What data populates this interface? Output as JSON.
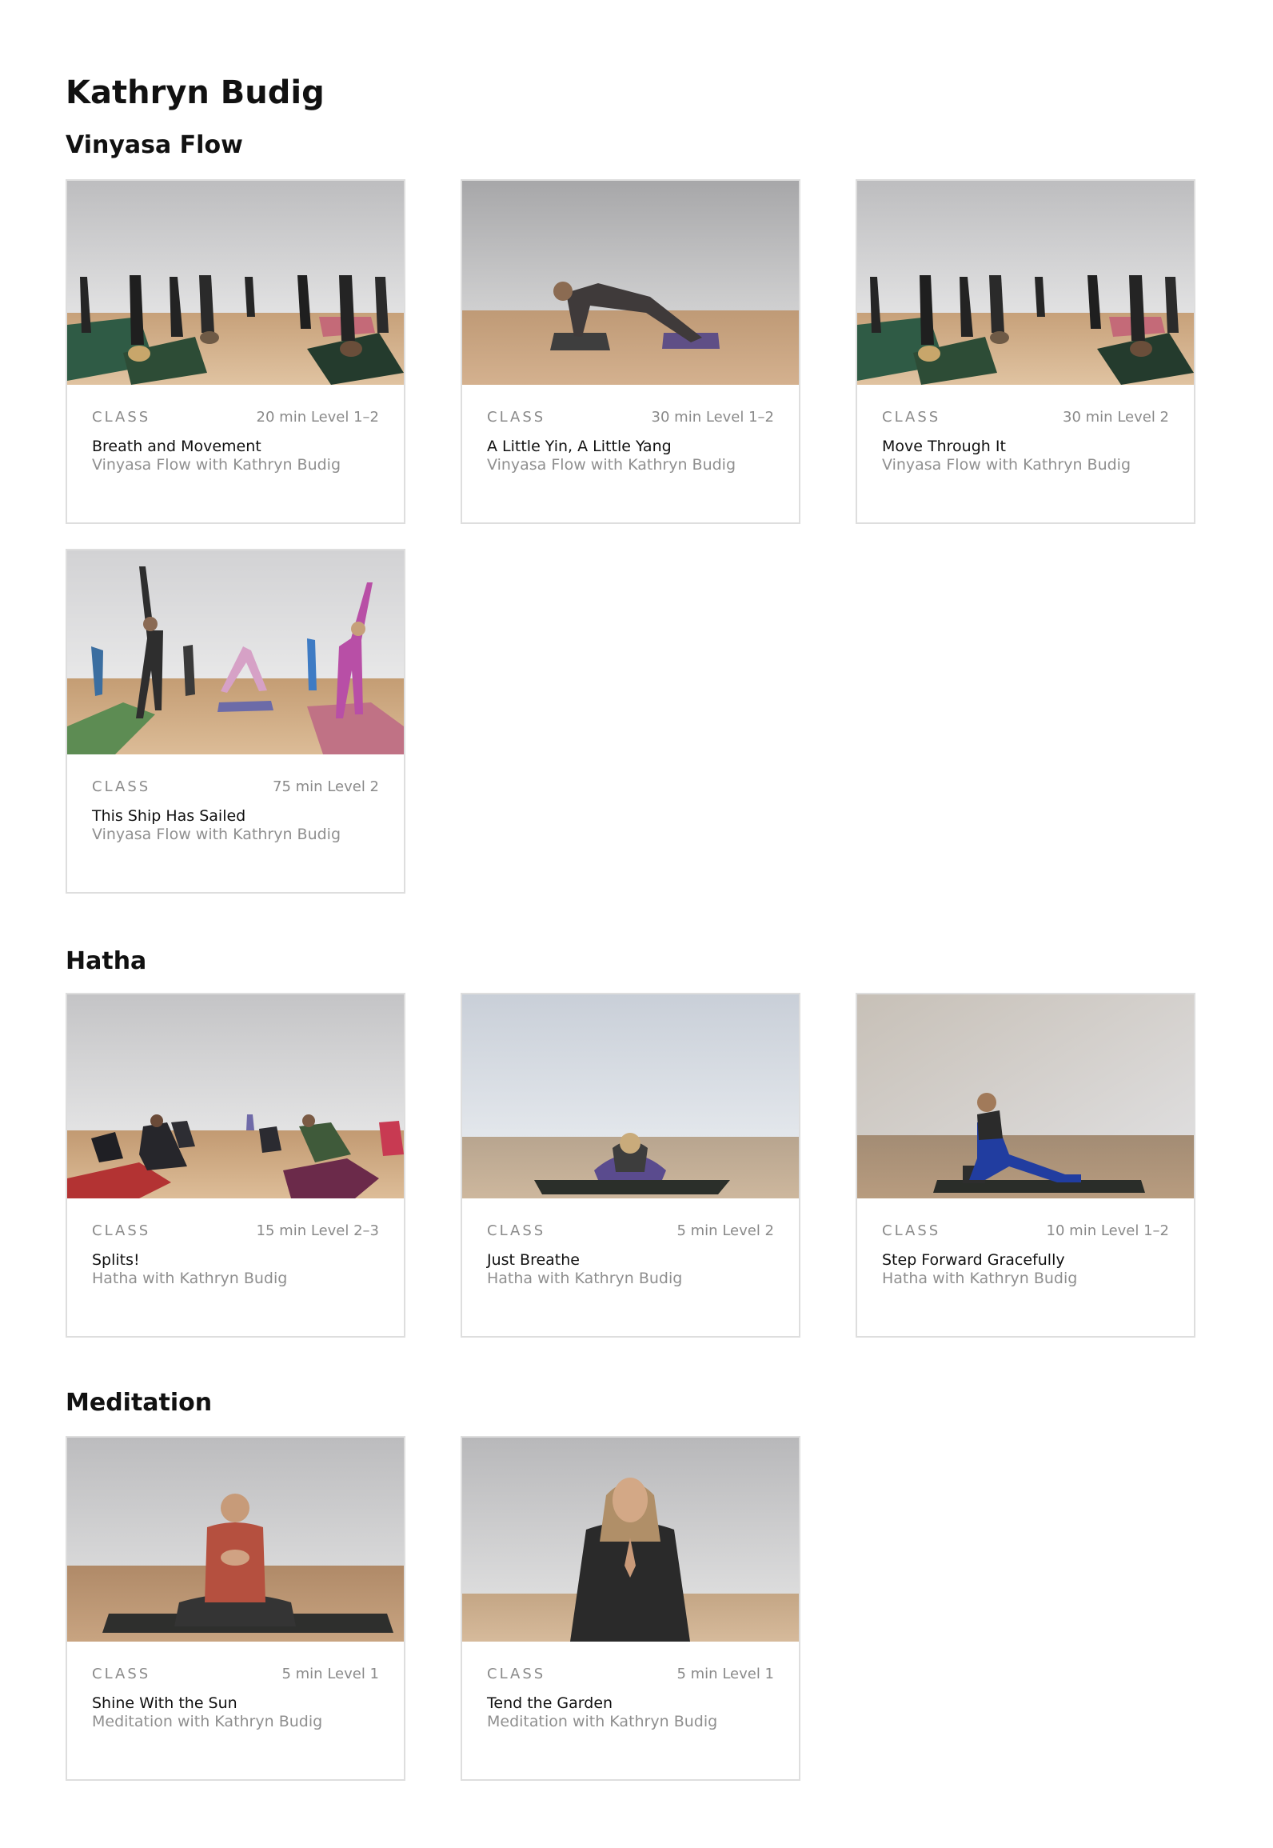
{
  "page": {
    "title": "Kathryn Budig"
  },
  "sections": [
    {
      "title": "Vinyasa Flow",
      "cards": [
        {
          "label": "CLASS",
          "duration": "20 min",
          "level": "Level 1–2",
          "title": "Breath and Movement",
          "subtitle": "Vinyasa Flow with Kathryn Budig"
        },
        {
          "label": "CLASS",
          "duration": "30 min",
          "level": "Level 1–2",
          "title": "A Little Yin, A Little Yang",
          "subtitle": "Vinyasa Flow with Kathryn Budig"
        },
        {
          "label": "CLASS",
          "duration": "30 min",
          "level": "Level 2",
          "title": "Move Through It",
          "subtitle": "Vinyasa Flow with Kathryn Budig"
        },
        {
          "label": "CLASS",
          "duration": "75 min",
          "level": "Level 2",
          "title": "This Ship Has Sailed",
          "subtitle": "Vinyasa Flow with Kathryn Budig"
        }
      ]
    },
    {
      "title": "Hatha",
      "cards": [
        {
          "label": "CLASS",
          "duration": "15 min",
          "level": "Level 2–3",
          "title": "Splits!",
          "subtitle": "Hatha with Kathryn Budig"
        },
        {
          "label": "CLASS",
          "duration": "5 min",
          "level": "Level 2",
          "title": "Just Breathe",
          "subtitle": "Hatha with Kathryn Budig"
        },
        {
          "label": "CLASS",
          "duration": "10 min",
          "level": "Level 1–2",
          "title": "Step Forward Gracefully",
          "subtitle": "Hatha with Kathryn Budig"
        }
      ]
    },
    {
      "title": "Meditation",
      "cards": [
        {
          "label": "CLASS",
          "duration": "5 min",
          "level": "Level 1",
          "title": "Shine With the Sun",
          "subtitle": "Meditation with Kathryn Budig"
        },
        {
          "label": "CLASS",
          "duration": "5 min",
          "level": "Level 1",
          "title": "Tend the Garden",
          "subtitle": "Meditation with Kathryn Budig"
        }
      ]
    }
  ]
}
